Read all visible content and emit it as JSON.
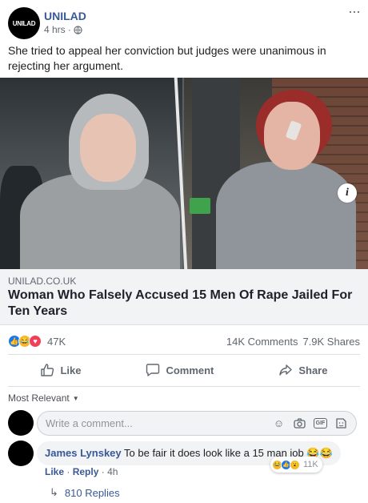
{
  "header": {
    "avatar_text": "UNILAD",
    "page_name": "UNILAD",
    "time": "4 hrs",
    "separator": "·"
  },
  "caption": "She tried to appeal her conviction but judges were unanimous in rejecting her argument.",
  "link": {
    "domain": "UNILAD.CO.UK",
    "title": "Woman Who Falsely Accused 15 Men Of Rape Jailed For Ten Years"
  },
  "reactions": {
    "count": "47K",
    "comments": "14K Comments",
    "shares": "7.9K Shares"
  },
  "actions": {
    "like": "Like",
    "comment": "Comment",
    "share": "Share"
  },
  "sort": {
    "label": "Most Relevant"
  },
  "composer": {
    "placeholder": "Write a comment..."
  },
  "comment": {
    "author": "James Lynskey",
    "text": "To be fair it does look like a 15 man job 😂😂",
    "reaction_count": "11K",
    "like": "Like",
    "reply": "Reply",
    "time": "4h",
    "dot": "·"
  },
  "replies": {
    "label": "810 Replies"
  },
  "colors": {
    "link_blue": "#385898",
    "like_blue": "#1877f2",
    "haha_yellow": "#f7b928",
    "love_red": "#f33e58"
  },
  "icons": [
    "globe-icon",
    "more-icon",
    "info-icon",
    "like-icon",
    "comment-icon",
    "share-icon",
    "emoji-icon",
    "camera-icon",
    "gif-icon",
    "sticker-icon",
    "reply-arrow-icon"
  ]
}
